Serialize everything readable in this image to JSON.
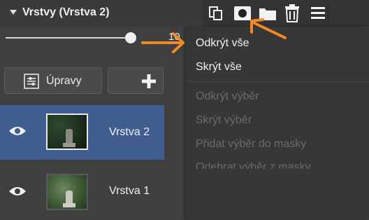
{
  "panel": {
    "title": "Vrstvy (Vrstva 2)",
    "icons": [
      "duplicate-layer-icon",
      "mask-icon",
      "folder-icon",
      "trash-icon",
      "menu-icon"
    ]
  },
  "slider": {
    "value": "10",
    "level_percent": 100
  },
  "buttons": {
    "adjustments_label": "Úpravy",
    "add_icon": "plus-icon"
  },
  "layers": [
    {
      "name": "Vrstva 2",
      "selected": true
    },
    {
      "name": "Vrstva 1",
      "selected": false
    }
  ],
  "menu": {
    "items": [
      {
        "label": "Odkrýt vše",
        "enabled": true
      },
      {
        "label": "Skrýt vše",
        "enabled": true
      },
      {
        "label": "Odkrýt výběr",
        "enabled": false
      },
      {
        "label": "Skrýt výběr",
        "enabled": false
      },
      {
        "label": "Přidat výběr do masky",
        "enabled": false
      },
      {
        "label": "Odebrat výběr z masky",
        "enabled": false
      }
    ]
  },
  "colors": {
    "accent_arrow": "#f08a24",
    "selected_row": "#3f5d8f"
  }
}
